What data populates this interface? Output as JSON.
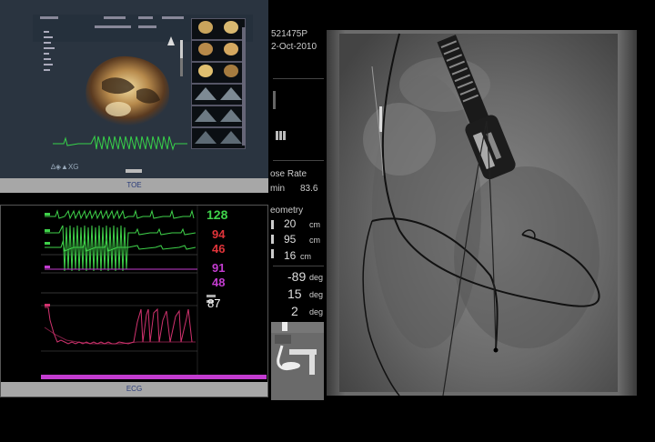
{
  "toe": {
    "label": "TOE"
  },
  "ecg": {
    "label": "ECG",
    "vitals": {
      "hr": "128",
      "v2": "94",
      "v3": "46",
      "v4": "91",
      "v5": "48",
      "v6": "87"
    },
    "colors": {
      "green": "#3fd24a",
      "red": "#e0343a",
      "magenta": "#c33cd0",
      "white": "#ffffff"
    }
  },
  "info": {
    "patient_id": "521475P",
    "date": "2-Oct-2010",
    "dose_rate_label": "ose Rate",
    "dose_unit": "min",
    "dose_value": "83.6",
    "geometry_label": "eometry",
    "geom1_value": "20",
    "geom1_unit": "cm",
    "geom2_value": "95",
    "geom2_unit": "cm",
    "geom3_value": "16",
    "geom3_unit": "cm",
    "angle1_value": "-89",
    "angle1_unit": "deg",
    "angle2_value": "15",
    "angle2_unit": "deg",
    "angle3_value": "2",
    "angle3_unit": "deg"
  }
}
